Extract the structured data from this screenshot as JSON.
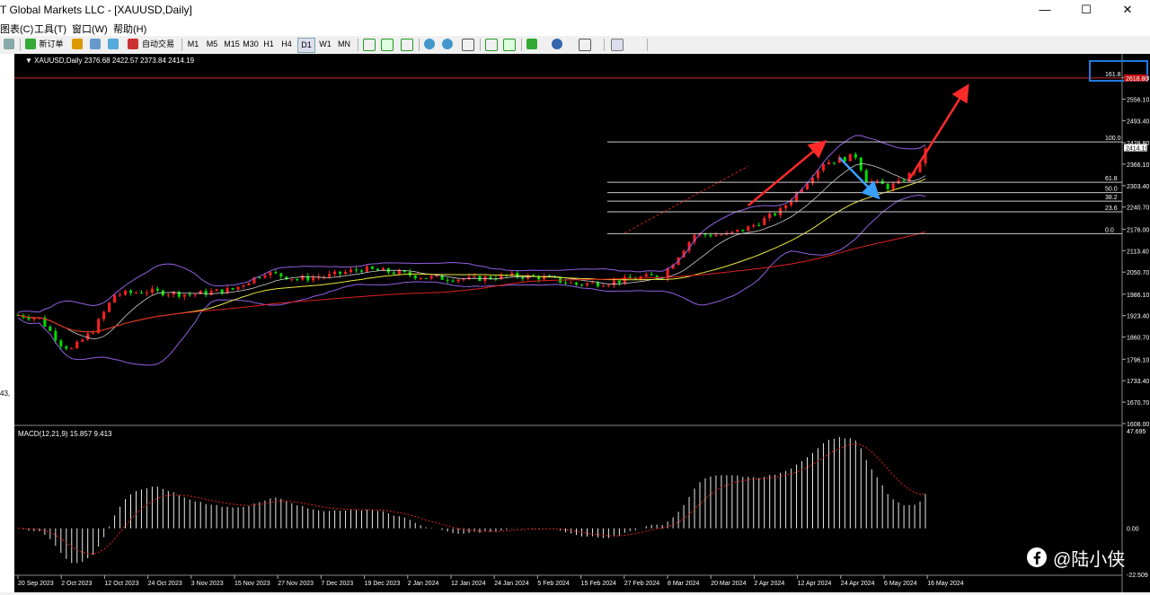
{
  "window": {
    "title": "T Global Markets LLC - [XAUUSD,Daily]",
    "minimize": "—",
    "maximize": "☐",
    "close": "✕"
  },
  "menu": [
    "图表(C)",
    "工具(T)",
    "窗口(W)",
    "帮助(H)"
  ],
  "toolbar": {
    "new_order": "新订单",
    "auto_trade": "自动交易",
    "timeframes": [
      "M1",
      "M5",
      "M15",
      "M30",
      "H1",
      "H4",
      "D1",
      "W1",
      "MN"
    ],
    "active_timeframe": "D1"
  },
  "left_margin_text": "43,",
  "chart": {
    "symbol_header": "XAUUSD,Daily",
    "ohlc": "2376.68 2422.57 2373.84 2414.19",
    "price_axis": [
      "2618.80",
      "2556.10",
      "2493.40",
      "2428.80",
      "2366.10",
      "2303.40",
      "2240.70",
      "2176.00",
      "2113.40",
      "2050.70",
      "1986.10",
      "1923.40",
      "1860.70",
      "1796.10",
      "1733.40",
      "1670.70",
      "1608.00"
    ],
    "current_price": "2414.19",
    "date_axis": [
      "20 Sep 2023",
      "2 Oct 2023",
      "12 Oct 2023",
      "24 Oct 2023",
      "3 Nov 2023",
      "15 Nov 2023",
      "27 Nov 2023",
      "7 Dec 2023",
      "19 Dec 2023",
      "2 Jan 2024",
      "12 Jan 2024",
      "24 Jan 2024",
      "5 Feb 2024",
      "15 Feb 2024",
      "27 Feb 2024",
      "8 Mar 2024",
      "20 Mar 2024",
      "2 Apr 2024",
      "12 Apr 2024",
      "24 Apr 2024",
      "6 May 2024",
      "16 May 2024"
    ],
    "fibonacci": [
      {
        "label": "161.8",
        "price": 2618
      },
      {
        "label": "100.0",
        "price": 2431
      },
      {
        "label": "61.8",
        "price": 2313
      },
      {
        "label": "50.0",
        "price": 2283
      },
      {
        "label": "38.2",
        "price": 2258
      },
      {
        "label": "23.6",
        "price": 2227
      },
      {
        "label": "0.0",
        "price": 2163
      }
    ],
    "highlight_price": "2618.80",
    "colors": {
      "bull": "#ff2020",
      "bear": "#00dd00",
      "ma_fast": "#ffffff",
      "ma_mid": "#e8e840",
      "ma_slow": "#e02020",
      "bands": "#9060e0",
      "arrow_up": "#ff2a2a",
      "arrow_down": "#3aa0ff",
      "highlight_box": "#1e7ae0"
    }
  },
  "macd": {
    "header": "MACD(12,21,9) 15.857 9.413",
    "axis": [
      "47.695",
      "0.00",
      "-22.509"
    ]
  },
  "watermark": {
    "text": "@陆小侠"
  }
}
